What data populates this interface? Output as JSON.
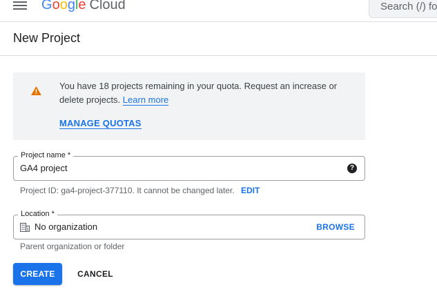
{
  "header": {
    "logo_letters": [
      "G",
      "o",
      "o",
      "g",
      "l",
      "e"
    ],
    "logo_product": "Cloud",
    "search_placeholder": "Search (/) for resources"
  },
  "page": {
    "title": "New Project"
  },
  "quota_notice": {
    "message": "You have 18 projects remaining in your quota. Request an increase or delete projects.",
    "learn_more": "Learn more",
    "manage_quotas": "MANAGE QUOTAS",
    "icon": "warning-icon",
    "icon_color": "#e37400"
  },
  "project_name": {
    "label": "Project name *",
    "value": "GA4 project",
    "help_icon": "?",
    "hint": "Project ID: ga4-project-377110. It cannot be changed later.",
    "edit_label": "EDIT"
  },
  "location": {
    "label": "Location *",
    "value": "No organization",
    "icon": "building-icon",
    "browse_label": "BROWSE",
    "hint": "Parent organization or folder"
  },
  "actions": {
    "create_label": "CREATE",
    "cancel_label": "CANCEL"
  },
  "colors": {
    "accent": "#1a73e8",
    "notice_bg": "#f1f3f4",
    "border": "#9aa0a6"
  }
}
